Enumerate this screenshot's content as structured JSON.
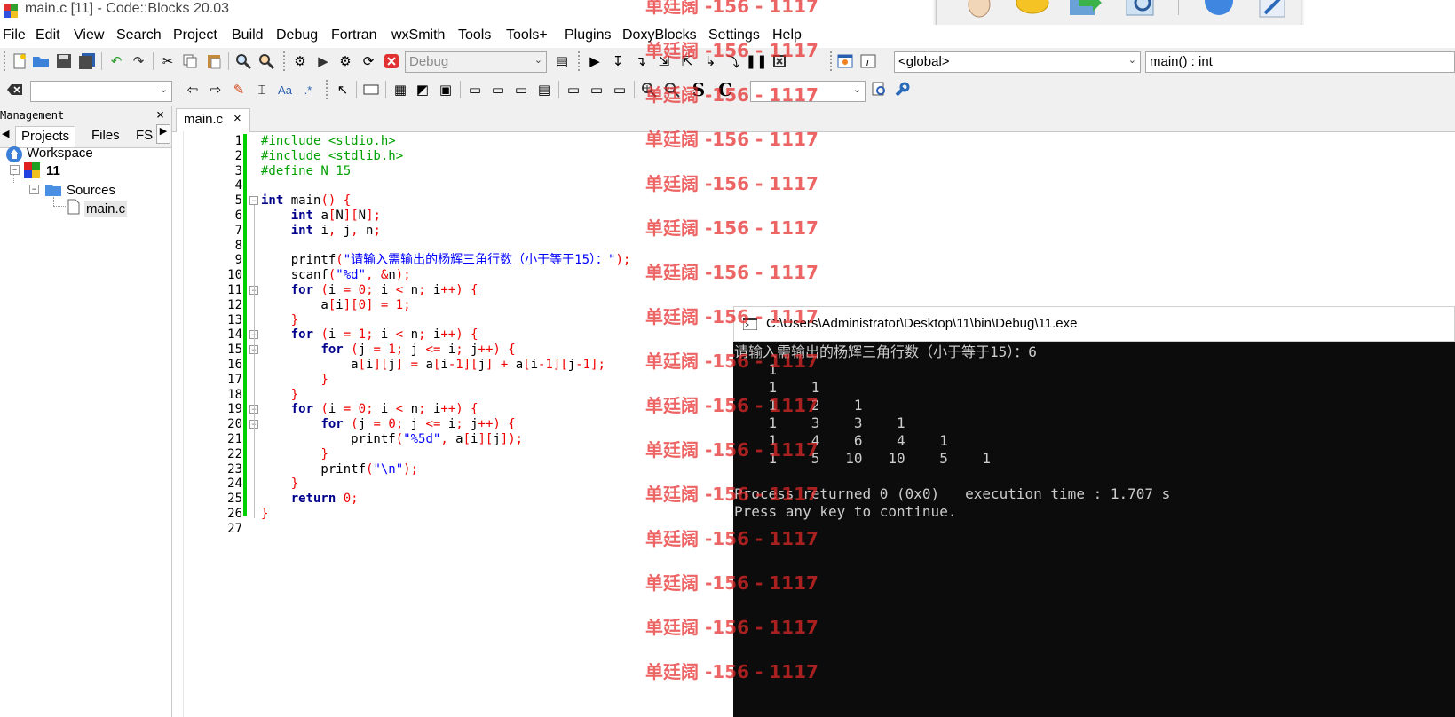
{
  "window": {
    "title": "main.c [11] - Code::Blocks 20.03"
  },
  "menu": [
    "File",
    "Edit",
    "View",
    "Search",
    "Project",
    "Build",
    "Debug",
    "Fortran",
    "wxSmith",
    "Tools",
    "Tools+",
    "Plugins",
    "DoxyBlocks",
    "Settings",
    "Help"
  ],
  "toolbar": {
    "build_target": "Debug",
    "scope": "<global>",
    "function": "main() : int",
    "search_value": "",
    "letters": [
      "S",
      "C"
    ]
  },
  "management": {
    "title": "Management",
    "close": "×",
    "tabs": [
      "Projects",
      "Files",
      "FS"
    ],
    "tree": {
      "workspace": "Workspace",
      "project": "11",
      "folder": "Sources",
      "file": "main.c"
    }
  },
  "editor": {
    "tab_label": "main.c",
    "tab_close": "×",
    "line_numbers": [
      "1",
      "2",
      "3",
      "4",
      "5",
      "6",
      "7",
      "8",
      "9",
      "10",
      "11",
      "12",
      "13",
      "14",
      "15",
      "16",
      "17",
      "18",
      "19",
      "20",
      "21",
      "22",
      "23",
      "24",
      "25",
      "26",
      "27"
    ],
    "code_lines": [
      "#include <stdio.h>",
      "#include <stdlib.h>",
      "#define N 15",
      "",
      "int main() {",
      "    int a[N][N];",
      "    int i, j, n;",
      "",
      "    printf(\"请输入需输出的杨辉三角行数（小于等于15）：\");",
      "    scanf(\"%d\", &n);",
      "    for (i = 0; i < n; i++) {",
      "        a[i][0] = 1;",
      "    }",
      "    for (i = 1; i < n; i++) {",
      "        for (j = 1; j <= i; j++) {",
      "            a[i][j] = a[i-1][j] + a[i-1][j-1];",
      "        }",
      "    }",
      "    for (i = 0; i < n; i++) {",
      "        for (j = 0; j <= i; j++) {",
      "            printf(\"%5d\", a[i][j]);",
      "        }",
      "        printf(\"\\n\");",
      "    }",
      "    return 0;",
      "}",
      ""
    ]
  },
  "console": {
    "title": "C:\\Users\\Administrator\\Desktop\\11\\bin\\Debug\\11.exe",
    "lines": [
      "请输入需输出的杨辉三角行数（小于等于15）：6",
      "    1",
      "    1    1",
      "    1    2    1",
      "    1    3    3    1",
      "    1    4    6    4    1",
      "    1    5   10   10    5    1",
      "",
      "Process returned 0 (0x0)   execution time : 1.707 s",
      "Press any key to continue."
    ]
  },
  "watermark": "单廷阔 -156 - 1117"
}
